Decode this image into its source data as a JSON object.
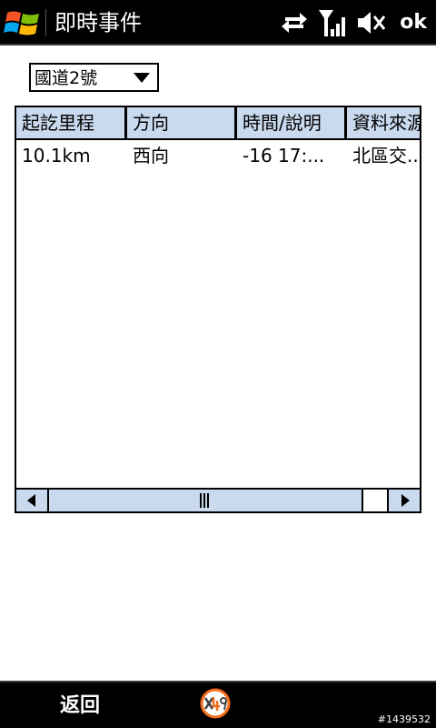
{
  "titlebar": {
    "title": "即時事件",
    "ok_label": "ok",
    "icons": [
      "windows-flag-icon",
      "data-connection-arrows-icon",
      "signal-strength-icon",
      "speaker-muted-icon"
    ]
  },
  "route_select": {
    "selected": "國道2號"
  },
  "table": {
    "columns": [
      "起訖里程",
      "方向",
      "時間/說明",
      "資料來源"
    ],
    "rows": [
      {
        "mileage": "10.1km",
        "direction": "西向",
        "time_desc": "-16 17:...",
        "source": "北區交..."
      }
    ]
  },
  "softkeys": {
    "left_label": "返回",
    "center_logo": "x49-logo"
  },
  "watermark": "#1439532",
  "colors": {
    "bar_background": "#000000",
    "header_fill": "#c9d9ee",
    "accent_logo": "#f26a1b"
  }
}
